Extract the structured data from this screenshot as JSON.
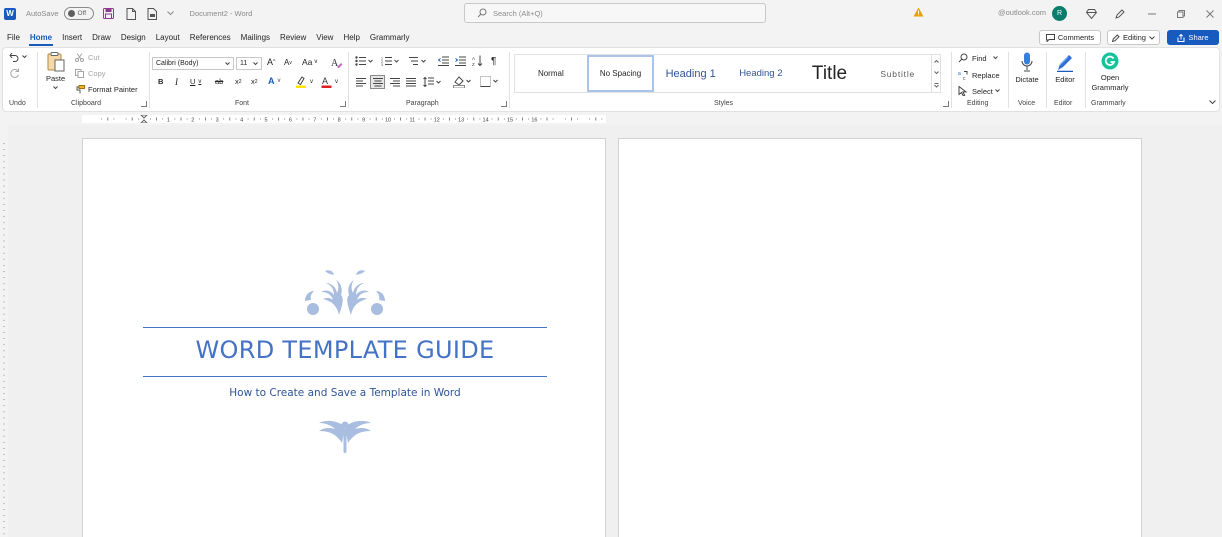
{
  "titlebar": {
    "autosave_label": "AutoSave",
    "autosave_state": "Off",
    "document_title": "Document2 - Word",
    "search_placeholder": "Search (Alt+Q)",
    "account_text": "@outlook.com",
    "avatar_initial": "R"
  },
  "tabs": [
    "File",
    "Home",
    "Insert",
    "Draw",
    "Design",
    "Layout",
    "References",
    "Mailings",
    "Review",
    "View",
    "Help",
    "Grammarly"
  ],
  "active_tab": "Home",
  "actions": {
    "comments": "Comments",
    "editing": "Editing",
    "share": "Share"
  },
  "ribbon": {
    "undo_group": "Undo",
    "clipboard": {
      "paste": "Paste",
      "cut": "Cut",
      "copy": "Copy",
      "format_painter": "Format Painter",
      "label": "Clipboard"
    },
    "font": {
      "family": "Calibri (Body)",
      "size": "11",
      "label": "Font"
    },
    "paragraph_label": "Paragraph",
    "styles": {
      "items": [
        "Normal",
        "No Spacing",
        "Heading 1",
        "Heading 2",
        "Title",
        "Subtitle"
      ],
      "selected": "No Spacing",
      "label": "Styles"
    },
    "editing": {
      "find": "Find",
      "replace": "Replace",
      "select": "Select",
      "label": "Editing"
    },
    "voice": {
      "dictate": "Dictate",
      "label": "Voice"
    },
    "editor": {
      "button": "Editor",
      "label": "Editor"
    },
    "grammarly": {
      "button_line1": "Open",
      "button_line2": "Grammarly",
      "label": "Grammarly"
    }
  },
  "ruler": {
    "numbers": [
      "1",
      "2",
      "3",
      "4",
      "5",
      "6",
      "7",
      "8",
      "9",
      "10",
      "11",
      "12",
      "13",
      "14",
      "15",
      "16"
    ]
  },
  "document": {
    "title": "WORD TEMPLATE GUIDE",
    "subtitle": "How to Create and Save a Template in Word"
  },
  "colors": {
    "accent": "#185abd",
    "doc_blue": "#4472c4",
    "ornament": "#a9bde0"
  }
}
